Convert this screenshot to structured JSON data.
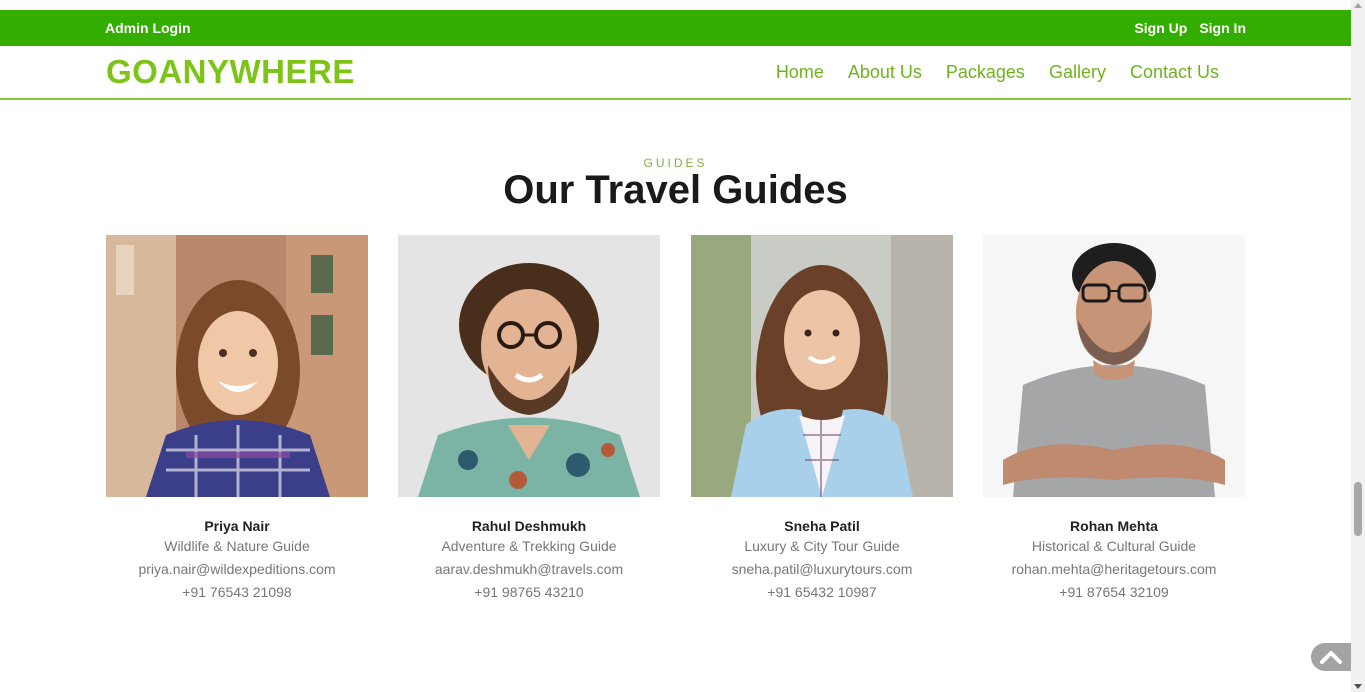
{
  "topbar": {
    "admin_login": "Admin Login",
    "sign_up": "Sign Up",
    "sign_in": "Sign In"
  },
  "navbar": {
    "logo": "GOANYWHERE",
    "links": [
      "Home",
      "About Us",
      "Packages",
      "Gallery",
      "Contact Us"
    ]
  },
  "section": {
    "label": "GUIDES",
    "title": "Our Travel Guides"
  },
  "guides": [
    {
      "name": "Priya Nair",
      "role": "Wildlife & Nature Guide",
      "email": "priya.nair@wildexpeditions.com",
      "phone": "+91 76543 21098"
    },
    {
      "name": "Rahul Deshmukh",
      "role": "Adventure & Trekking Guide",
      "email": "aarav.deshmukh@travels.com",
      "phone": "+91 98765 43210"
    },
    {
      "name": "Sneha Patil",
      "role": "Luxury & City Tour Guide",
      "email": "sneha.patil@luxurytours.com",
      "phone": "+91 65432 10987"
    },
    {
      "name": "Rohan Mehta",
      "role": "Historical & Cultural Guide",
      "email": "rohan.mehta@heritagetours.com",
      "phone": "+91 87654 32109"
    }
  ],
  "icons": {
    "back_to_top": "chevron-up-icon"
  },
  "colors": {
    "topbar": "#33ad00",
    "accent": "#7dc418"
  }
}
